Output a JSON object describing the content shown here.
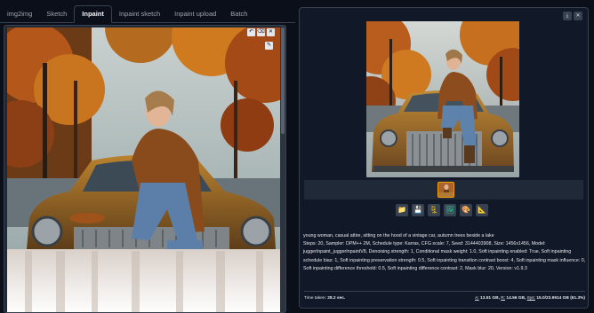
{
  "tabs": [
    {
      "label": "img2img",
      "active": false
    },
    {
      "label": "Sketch",
      "active": false
    },
    {
      "label": "Inpaint",
      "active": true
    },
    {
      "label": "Inpaint sketch",
      "active": false
    },
    {
      "label": "Inpaint upload",
      "active": false
    },
    {
      "label": "Batch",
      "active": false
    }
  ],
  "canvas": {
    "tools": [
      {
        "icon": "undo-icon",
        "glyph": "↶"
      },
      {
        "icon": "eraser-icon",
        "glyph": "⌫"
      },
      {
        "icon": "close-icon",
        "glyph": "✕"
      }
    ],
    "brush_glyph": "✎"
  },
  "output": {
    "controls": [
      {
        "icon": "download-icon",
        "glyph": "⤓"
      },
      {
        "icon": "close-icon",
        "glyph": "✕"
      }
    ],
    "actions": [
      {
        "icon": "folder-icon",
        "glyph": "📁",
        "color": "#f59e0b"
      },
      {
        "icon": "save-icon",
        "glyph": "💾",
        "color": "#c084fc"
      },
      {
        "icon": "zip-icon",
        "glyph": "🗜",
        "color": "#facc15"
      },
      {
        "icon": "send-to-img2img-icon",
        "glyph": "🖼",
        "color": "#34d399"
      },
      {
        "icon": "send-to-inpaint-icon",
        "glyph": "🎨",
        "color": "#fb7185"
      },
      {
        "icon": "send-to-extras-icon",
        "glyph": "📐",
        "color": "#93c5fd"
      }
    ],
    "prompt": "young woman, casual attire, sitting on the hood of a vintage car, autumn trees beside a lake",
    "params": "Steps: 20, Sampler: DPM++ 2M, Schedule type: Karras, CFG scale: 7, Seed: 3144403908, Size: 1456x1456, Model: juggerInpaint_juggerInpaintV8, Denoising strength: 1, Conditional mask weight: 1.0, Soft inpainting enabled: True, Soft inpainting schedule bias: 1, Soft inpainting preservation strength: 0.5, Soft inpainting transition contrast boost: 4, Soft inpainting mask influence: 0, Soft inpainting difference threshold: 0.5, Soft inpainting difference contrast: 2, Mask blur: 20, Version: v1.9.3",
    "time_label": "Time taken:",
    "time_value": "28.2 sec.",
    "memory": {
      "a_label": "A:",
      "a_value": "13.51 GB,",
      "r_label": "R:",
      "r_value": "14.56 GB,",
      "sys_label": "Sys:",
      "sys_value": "15.0/23.9914 GB (61.3%)"
    }
  }
}
